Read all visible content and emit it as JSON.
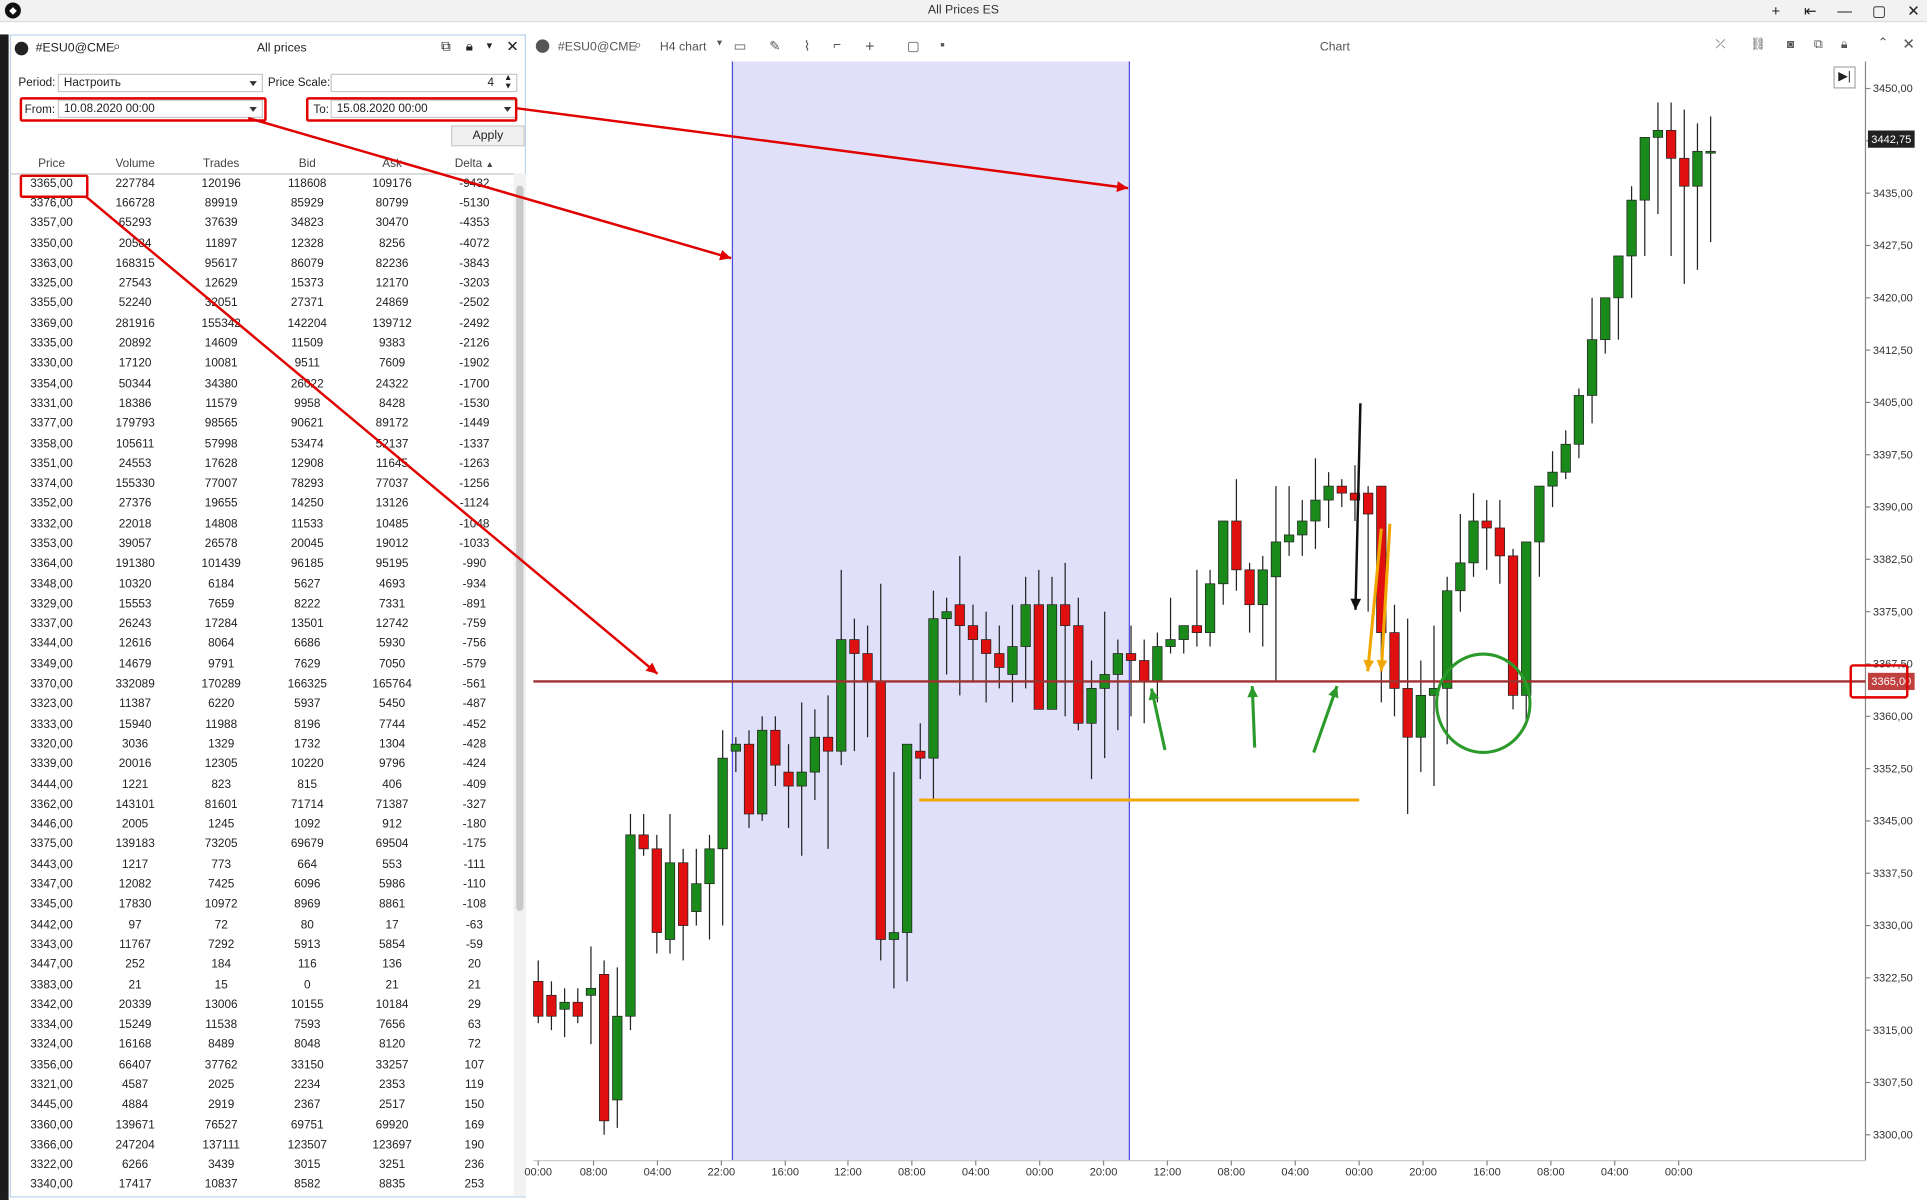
{
  "window": {
    "title": "All Prices ES"
  },
  "window_buttons": [
    "+",
    "⇤",
    "—",
    "▢",
    "✕"
  ],
  "left_panel": {
    "symbol": "#ESU0@CME",
    "title": "All prices",
    "period_label": "Period:",
    "period_value": "Настроить",
    "price_scale_label": "Price Scale:",
    "price_scale_value": "4",
    "from_label": "From:",
    "from_value": "10.08.2020 00:00",
    "to_label": "To:",
    "to_value": "15.08.2020 00:00",
    "apply_label": "Apply",
    "columns": [
      "Price",
      "Volume",
      "Trades",
      "Bid",
      "Ask",
      "Delta"
    ],
    "rows": [
      [
        "3365,00",
        "227784",
        "120196",
        "118608",
        "109176",
        "-9432"
      ],
      [
        "3376,00",
        "166728",
        "89919",
        "85929",
        "80799",
        "-5130"
      ],
      [
        "3357,00",
        "65293",
        "37639",
        "34823",
        "30470",
        "-4353"
      ],
      [
        "3350,00",
        "20584",
        "11897",
        "12328",
        "8256",
        "-4072"
      ],
      [
        "3363,00",
        "168315",
        "95617",
        "86079",
        "82236",
        "-3843"
      ],
      [
        "3325,00",
        "27543",
        "12629",
        "15373",
        "12170",
        "-3203"
      ],
      [
        "3355,00",
        "52240",
        "32051",
        "27371",
        "24869",
        "-2502"
      ],
      [
        "3369,00",
        "281916",
        "155342",
        "142204",
        "139712",
        "-2492"
      ],
      [
        "3335,00",
        "20892",
        "14609",
        "11509",
        "9383",
        "-2126"
      ],
      [
        "3330,00",
        "17120",
        "10081",
        "9511",
        "7609",
        "-1902"
      ],
      [
        "3354,00",
        "50344",
        "34380",
        "26022",
        "24322",
        "-1700"
      ],
      [
        "3331,00",
        "18386",
        "11579",
        "9958",
        "8428",
        "-1530"
      ],
      [
        "3377,00",
        "179793",
        "98565",
        "90621",
        "89172",
        "-1449"
      ],
      [
        "3358,00",
        "105611",
        "57998",
        "53474",
        "52137",
        "-1337"
      ],
      [
        "3351,00",
        "24553",
        "17628",
        "12908",
        "11645",
        "-1263"
      ],
      [
        "3374,00",
        "155330",
        "77007",
        "78293",
        "77037",
        "-1256"
      ],
      [
        "3352,00",
        "27376",
        "19655",
        "14250",
        "13126",
        "-1124"
      ],
      [
        "3332,00",
        "22018",
        "14808",
        "11533",
        "10485",
        "-1048"
      ],
      [
        "3353,00",
        "39057",
        "26578",
        "20045",
        "19012",
        "-1033"
      ],
      [
        "3364,00",
        "191380",
        "101439",
        "96185",
        "95195",
        "-990"
      ],
      [
        "3348,00",
        "10320",
        "6184",
        "5627",
        "4693",
        "-934"
      ],
      [
        "3329,00",
        "15553",
        "7659",
        "8222",
        "7331",
        "-891"
      ],
      [
        "3337,00",
        "26243",
        "17284",
        "13501",
        "12742",
        "-759"
      ],
      [
        "3344,00",
        "12616",
        "8064",
        "6686",
        "5930",
        "-756"
      ],
      [
        "3349,00",
        "14679",
        "9791",
        "7629",
        "7050",
        "-579"
      ],
      [
        "3370,00",
        "332089",
        "170289",
        "166325",
        "165764",
        "-561"
      ],
      [
        "3323,00",
        "11387",
        "6220",
        "5937",
        "5450",
        "-487"
      ],
      [
        "3333,00",
        "15940",
        "11988",
        "8196",
        "7744",
        "-452"
      ],
      [
        "3320,00",
        "3036",
        "1329",
        "1732",
        "1304",
        "-428"
      ],
      [
        "3339,00",
        "20016",
        "12305",
        "10220",
        "9796",
        "-424"
      ],
      [
        "3444,00",
        "1221",
        "823",
        "815",
        "406",
        "-409"
      ],
      [
        "3362,00",
        "143101",
        "81601",
        "71714",
        "71387",
        "-327"
      ],
      [
        "3446,00",
        "2005",
        "1245",
        "1092",
        "912",
        "-180"
      ],
      [
        "3375,00",
        "139183",
        "73205",
        "69679",
        "69504",
        "-175"
      ],
      [
        "3443,00",
        "1217",
        "773",
        "664",
        "553",
        "-111"
      ],
      [
        "3347,00",
        "12082",
        "7425",
        "6096",
        "5986",
        "-110"
      ],
      [
        "3345,00",
        "17830",
        "10972",
        "8969",
        "8861",
        "-108"
      ],
      [
        "3442,00",
        "97",
        "72",
        "80",
        "17",
        "-63"
      ],
      [
        "3343,00",
        "11767",
        "7292",
        "5913",
        "5854",
        "-59"
      ],
      [
        "3447,00",
        "252",
        "184",
        "116",
        "136",
        "20"
      ],
      [
        "3383,00",
        "21",
        "15",
        "0",
        "21",
        "21"
      ],
      [
        "3342,00",
        "20339",
        "13006",
        "10155",
        "10184",
        "29"
      ],
      [
        "3334,00",
        "15249",
        "11538",
        "7593",
        "7656",
        "63"
      ],
      [
        "3324,00",
        "16168",
        "8489",
        "8048",
        "8120",
        "72"
      ],
      [
        "3356,00",
        "66407",
        "37762",
        "33150",
        "33257",
        "107"
      ],
      [
        "3321,00",
        "4587",
        "2025",
        "2234",
        "2353",
        "119"
      ],
      [
        "3445,00",
        "4884",
        "2919",
        "2367",
        "2517",
        "150"
      ],
      [
        "3360,00",
        "139671",
        "76527",
        "69751",
        "69920",
        "169"
      ],
      [
        "3366,00",
        "247204",
        "137111",
        "123507",
        "123697",
        "190"
      ],
      [
        "3322,00",
        "6266",
        "3439",
        "3015",
        "3251",
        "236"
      ],
      [
        "3340,00",
        "17417",
        "10837",
        "8582",
        "8835",
        "253"
      ]
    ]
  },
  "chart_panel": {
    "symbol": "#ESU0@CME",
    "timeframe": "H4 chart",
    "title": "Chart",
    "last_price_label": "3442,75",
    "level_price_label": "3365,00"
  },
  "colors": {
    "up": "#1a8a1a",
    "down": "#e01010",
    "level": "#a03030",
    "highlight": "#e0e0fa",
    "annot_red": "#e00000",
    "annot_orange": "#f0a800",
    "annot_green": "#2a9a2a"
  },
  "chart_data": {
    "type": "candlestick",
    "ylim": [
      3297,
      3453
    ],
    "y_ticks": [
      "3450,00",
      "3442,50",
      "3435,00",
      "3427,50",
      "3420,00",
      "3412,50",
      "3405,00",
      "3397,50",
      "3390,00",
      "3382,50",
      "3375,00",
      "3367,50",
      "3360,00",
      "3352,50",
      "3345,00",
      "3337,50",
      "3330,00",
      "3322,50",
      "3315,00",
      "3307,50",
      "3300,00"
    ],
    "x_ticks": [
      "00:00",
      "08:00",
      "04:00",
      "22:00",
      "16:00",
      "12:00",
      "08:00",
      "04:00",
      "00:00",
      "20:00",
      "12:00",
      "08:00",
      "04:00",
      "00:00",
      "20:00",
      "16:00",
      "08:00",
      "04:00",
      "00:00"
    ],
    "level": 3365.0,
    "orange_level": 3348.0,
    "candles": [
      [
        3322,
        3325,
        3316,
        3317
      ],
      [
        3320,
        3322,
        3315,
        3317
      ],
      [
        3318,
        3321,
        3314,
        3319
      ],
      [
        3319,
        3321,
        3316,
        3317
      ],
      [
        3320,
        3327,
        3313,
        3321
      ],
      [
        3323,
        3325,
        3300,
        3302
      ],
      [
        3305,
        3324,
        3301,
        3317
      ],
      [
        3317,
        3346,
        3315,
        3343
      ],
      [
        3343,
        3346,
        3340,
        3341
      ],
      [
        3341,
        3343,
        3326,
        3329
      ],
      [
        3328,
        3346,
        3326,
        3339
      ],
      [
        3339,
        3341,
        3325,
        3330
      ],
      [
        3332,
        3341,
        3330,
        3336
      ],
      [
        3336,
        3343,
        3328,
        3341
      ],
      [
        3341,
        3358,
        3330,
        3354
      ],
      [
        3355,
        3357,
        3352,
        3356
      ],
      [
        3356,
        3358,
        3344,
        3346
      ],
      [
        3346,
        3360,
        3345,
        3358
      ],
      [
        3358,
        3360,
        3350,
        3353
      ],
      [
        3352,
        3356,
        3344,
        3350
      ],
      [
        3350,
        3362,
        3340,
        3352
      ],
      [
        3352,
        3361,
        3348,
        3357
      ],
      [
        3357,
        3363,
        3341,
        3355
      ],
      [
        3355,
        3381,
        3353,
        3371
      ],
      [
        3371,
        3374,
        3355,
        3369
      ],
      [
        3369,
        3373,
        3357,
        3365
      ],
      [
        3365,
        3379,
        3325,
        3328
      ],
      [
        3328,
        3352,
        3321,
        3329
      ],
      [
        3329,
        3348,
        3322,
        3356
      ],
      [
        3355,
        3359,
        3351,
        3354
      ],
      [
        3354,
        3378,
        3348,
        3374
      ],
      [
        3374,
        3377,
        3366,
        3375
      ],
      [
        3376,
        3383,
        3363,
        3373
      ],
      [
        3373,
        3376,
        3365,
        3371
      ],
      [
        3371,
        3375,
        3362,
        3369
      ],
      [
        3369,
        3373,
        3364,
        3367
      ],
      [
        3366,
        3376,
        3362,
        3370
      ],
      [
        3370,
        3380,
        3364,
        3376
      ],
      [
        3376,
        3381,
        3362,
        3361
      ],
      [
        3361,
        3380,
        3363,
        3376
      ],
      [
        3376,
        3382,
        3360,
        3373
      ],
      [
        3373,
        3377,
        3358,
        3359
      ],
      [
        3359,
        3368,
        3351,
        3364
      ],
      [
        3364,
        3375,
        3354,
        3366
      ],
      [
        3366,
        3371,
        3358,
        3369
      ],
      [
        3369,
        3373,
        3360,
        3368
      ],
      [
        3368,
        3371,
        3359,
        3365
      ],
      [
        3365,
        3372,
        3362,
        3370
      ],
      [
        3370,
        3377,
        3369,
        3371
      ],
      [
        3371,
        3373,
        3369,
        3373
      ],
      [
        3373,
        3381,
        3370,
        3372
      ],
      [
        3372,
        3381,
        3370,
        3379
      ],
      [
        3379,
        3387,
        3376,
        3388
      ],
      [
        3388,
        3394,
        3378,
        3381
      ],
      [
        3381,
        3382,
        3372,
        3376
      ],
      [
        3376,
        3383,
        3370,
        3381
      ],
      [
        3380,
        3393,
        3365,
        3385
      ],
      [
        3385,
        3393,
        3383,
        3386
      ],
      [
        3386,
        3391,
        3383,
        3388
      ],
      [
        3388,
        3397,
        3384,
        3391
      ],
      [
        3391,
        3395,
        3387,
        3393
      ],
      [
        3393,
        3394,
        3390,
        3392
      ],
      [
        3392,
        3396,
        3388,
        3391
      ],
      [
        3392,
        3393,
        3375,
        3389
      ],
      [
        3393,
        3392,
        3362,
        3372
      ],
      [
        3372,
        3376,
        3360,
        3364
      ],
      [
        3364,
        3374,
        3346,
        3357
      ],
      [
        3357,
        3368,
        3352,
        3363
      ],
      [
        3363,
        3373,
        3350,
        3364
      ],
      [
        3364,
        3380,
        3356,
        3378
      ],
      [
        3378,
        3389,
        3375,
        3382
      ],
      [
        3382,
        3392,
        3380,
        3388
      ],
      [
        3388,
        3391,
        3381,
        3387
      ],
      [
        3387,
        3391,
        3379,
        3383
      ],
      [
        3383,
        3384,
        3361,
        3363
      ],
      [
        3363,
        3385,
        3359,
        3385
      ],
      [
        3385,
        3393,
        3380,
        3393
      ],
      [
        3393,
        3398,
        3390,
        3395
      ],
      [
        3395,
        3401,
        3394,
        3399
      ],
      [
        3399,
        3407,
        3397,
        3406
      ],
      [
        3406,
        3420,
        3402,
        3414
      ],
      [
        3414,
        3420,
        3412,
        3420
      ],
      [
        3420,
        3424,
        3414,
        3426
      ],
      [
        3426,
        3436,
        3420,
        3434
      ],
      [
        3434,
        3440,
        3426,
        3443
      ],
      [
        3443,
        3448,
        3432,
        3444
      ],
      [
        3444,
        3448,
        3426,
        3440
      ],
      [
        3440,
        3447,
        3422,
        3436
      ],
      [
        3436,
        3445,
        3424,
        3441
      ],
      [
        3441,
        3446,
        3428,
        3441
      ]
    ]
  }
}
